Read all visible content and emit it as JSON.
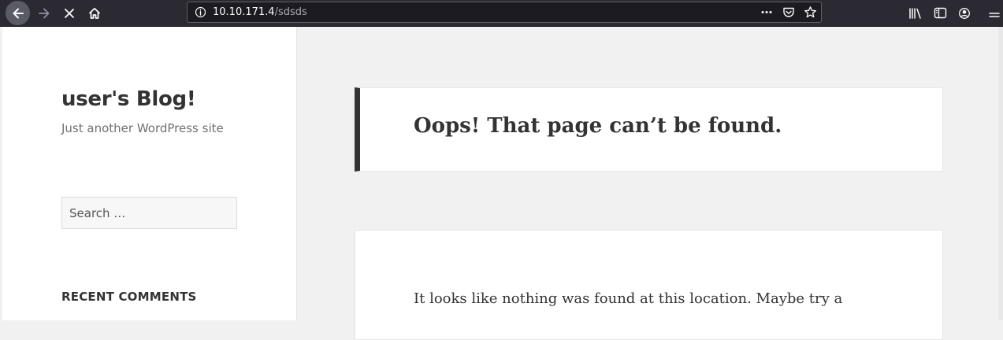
{
  "browser": {
    "url_host": "10.10.171.4",
    "url_path": "/sdsds",
    "icons": {
      "back": "back-arrow-icon",
      "forward": "forward-arrow-icon",
      "stop": "stop-icon",
      "home": "home-icon",
      "info": "info-icon",
      "page_actions": "more-icon",
      "pocket": "pocket-icon",
      "bookmark": "star-icon",
      "library": "library-icon",
      "sidebar": "sidebar-icon",
      "account": "account-icon",
      "menu": "hamburger-menu-icon"
    }
  },
  "site": {
    "title": "user's Blog!",
    "tagline": "Just another WordPress site",
    "search": {
      "placeholder": "Search …"
    },
    "widgets": {
      "recent_comments": "RECENT COMMENTS"
    }
  },
  "main": {
    "page_title": "Oops! That page can’t be found.",
    "body_text": "It looks like nothing was found at this location. Maybe try a"
  },
  "colors": {
    "toolbar_bg": "#2b2a33",
    "page_bg": "#f1f1f1",
    "heading": "#333333"
  }
}
